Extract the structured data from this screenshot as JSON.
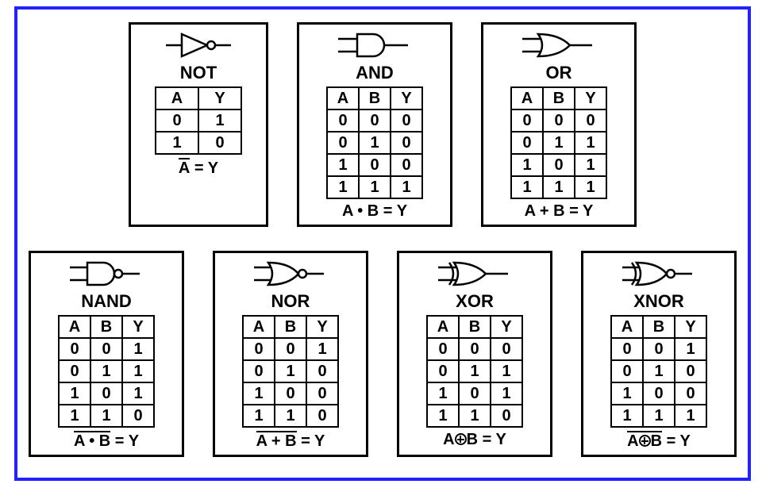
{
  "gates": {
    "not": {
      "name": "NOT",
      "headers": [
        "A",
        "Y"
      ],
      "rows": [
        [
          "0",
          "1"
        ],
        [
          "1",
          "0"
        ]
      ],
      "expr_lhs_bar": "A",
      "expr_eq": " = ",
      "expr_rhs": "Y"
    },
    "and": {
      "name": "AND",
      "headers": [
        "A",
        "B",
        "Y"
      ],
      "rows": [
        [
          "0",
          "0",
          "0"
        ],
        [
          "0",
          "1",
          "0"
        ],
        [
          "1",
          "0",
          "0"
        ],
        [
          "1",
          "1",
          "1"
        ]
      ],
      "expr_A": "A",
      "expr_dot": " • ",
      "expr_B": "B",
      "expr_eq": " = ",
      "expr_rhs": "Y"
    },
    "or": {
      "name": "OR",
      "headers": [
        "A",
        "B",
        "Y"
      ],
      "rows": [
        [
          "0",
          "0",
          "0"
        ],
        [
          "0",
          "1",
          "1"
        ],
        [
          "1",
          "0",
          "1"
        ],
        [
          "1",
          "1",
          "1"
        ]
      ],
      "expr_A": "A",
      "expr_plus": " + ",
      "expr_B": "B",
      "expr_eq": " = ",
      "expr_rhs": "Y"
    },
    "nand": {
      "name": "NAND",
      "headers": [
        "A",
        "B",
        "Y"
      ],
      "rows": [
        [
          "0",
          "0",
          "1"
        ],
        [
          "0",
          "1",
          "1"
        ],
        [
          "1",
          "0",
          "1"
        ],
        [
          "1",
          "1",
          "0"
        ]
      ],
      "expr_A": "A",
      "expr_dot": " • ",
      "expr_B": "B",
      "expr_eq": " = ",
      "expr_rhs": "Y"
    },
    "nor": {
      "name": "NOR",
      "headers": [
        "A",
        "B",
        "Y"
      ],
      "rows": [
        [
          "0",
          "0",
          "1"
        ],
        [
          "0",
          "1",
          "0"
        ],
        [
          "1",
          "0",
          "0"
        ],
        [
          "1",
          "1",
          "0"
        ]
      ],
      "expr_A": "A",
      "expr_plus": " + ",
      "expr_B": "B",
      "expr_eq": " = ",
      "expr_rhs": "Y"
    },
    "xor": {
      "name": "XOR",
      "headers": [
        "A",
        "B",
        "Y"
      ],
      "rows": [
        [
          "0",
          "0",
          "0"
        ],
        [
          "0",
          "1",
          "1"
        ],
        [
          "1",
          "0",
          "1"
        ],
        [
          "1",
          "1",
          "0"
        ]
      ],
      "expr_A": "A",
      "expr_B": "B",
      "expr_eq": " = ",
      "expr_rhs": "Y"
    },
    "xnor": {
      "name": "XNOR",
      "headers": [
        "A",
        "B",
        "Y"
      ],
      "rows": [
        [
          "0",
          "0",
          "1"
        ],
        [
          "0",
          "1",
          "0"
        ],
        [
          "1",
          "0",
          "0"
        ],
        [
          "1",
          "1",
          "1"
        ]
      ],
      "expr_A": "A",
      "expr_B": "B",
      "expr_eq": " = ",
      "expr_rhs": "Y"
    }
  },
  "chart_data": [
    {
      "type": "table",
      "title": "NOT",
      "headers": [
        "A",
        "Y"
      ],
      "rows": [
        [
          0,
          1
        ],
        [
          1,
          0
        ]
      ],
      "expression": "Ā = Y"
    },
    {
      "type": "table",
      "title": "AND",
      "headers": [
        "A",
        "B",
        "Y"
      ],
      "rows": [
        [
          0,
          0,
          0
        ],
        [
          0,
          1,
          0
        ],
        [
          1,
          0,
          0
        ],
        [
          1,
          1,
          1
        ]
      ],
      "expression": "A · B = Y"
    },
    {
      "type": "table",
      "title": "OR",
      "headers": [
        "A",
        "B",
        "Y"
      ],
      "rows": [
        [
          0,
          0,
          0
        ],
        [
          0,
          1,
          1
        ],
        [
          1,
          0,
          1
        ],
        [
          1,
          1,
          1
        ]
      ],
      "expression": "A + B = Y"
    },
    {
      "type": "table",
      "title": "NAND",
      "headers": [
        "A",
        "B",
        "Y"
      ],
      "rows": [
        [
          0,
          0,
          1
        ],
        [
          0,
          1,
          1
        ],
        [
          1,
          0,
          1
        ],
        [
          1,
          1,
          0
        ]
      ],
      "expression": "overline(A · B) = Y"
    },
    {
      "type": "table",
      "title": "NOR",
      "headers": [
        "A",
        "B",
        "Y"
      ],
      "rows": [
        [
          0,
          0,
          1
        ],
        [
          0,
          1,
          0
        ],
        [
          1,
          0,
          0
        ],
        [
          1,
          1,
          0
        ]
      ],
      "expression": "overline(A + B) = Y"
    },
    {
      "type": "table",
      "title": "XOR",
      "headers": [
        "A",
        "B",
        "Y"
      ],
      "rows": [
        [
          0,
          0,
          0
        ],
        [
          0,
          1,
          1
        ],
        [
          1,
          0,
          1
        ],
        [
          1,
          1,
          0
        ]
      ],
      "expression": "A ⊕ B = Y"
    },
    {
      "type": "table",
      "title": "XNOR",
      "headers": [
        "A",
        "B",
        "Y"
      ],
      "rows": [
        [
          0,
          0,
          1
        ],
        [
          0,
          1,
          0
        ],
        [
          1,
          0,
          0
        ],
        [
          1,
          1,
          1
        ]
      ],
      "expression": "overline(A ⊕ B) = Y"
    }
  ]
}
